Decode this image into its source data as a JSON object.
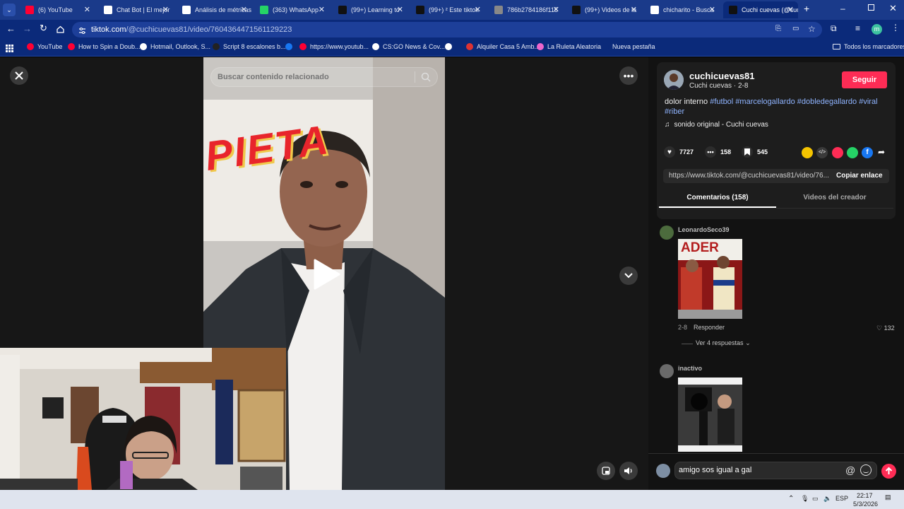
{
  "tabs": [
    {
      "label": "(6) YouTube",
      "icon": "youtube-icon",
      "color": "#ff0033"
    },
    {
      "label": "Chat Bot | El mejor",
      "icon": "chatbot-icon",
      "color": "#ffffff"
    },
    {
      "label": "Análisis de métricas",
      "icon": "analytics-icon",
      "color": "#ffffff"
    },
    {
      "label": "(363) WhatsApp",
      "icon": "whatsapp-icon",
      "color": "#25d366"
    },
    {
      "label": "(99+) Learning to",
      "icon": "tiktok-icon",
      "color": "#111111"
    },
    {
      "label": "(99+) ² Este tiktok",
      "icon": "tiktok-icon",
      "color": "#111111"
    },
    {
      "label": "786b2784186f115",
      "icon": "globe-icon",
      "color": "#888888"
    },
    {
      "label": "(99+) Videos de la",
      "icon": "tiktok-icon",
      "color": "#111111"
    },
    {
      "label": "chicharito - Busca",
      "icon": "google-icon",
      "color": "#ffffff"
    },
    {
      "label": "Cuchi cuevas (@cuchi",
      "icon": "tiktok-icon",
      "color": "#111111"
    }
  ],
  "address": {
    "host": "tiktok.com",
    "path": "/@cuchicuevas81/video/7604364471561129223"
  },
  "bookmarks": [
    {
      "label": "YouTube",
      "color": "#ff0033"
    },
    {
      "label": "How to Spin a Doub...",
      "color": "#ff0033"
    },
    {
      "label": "Hotmail, Outlook, S...",
      "color": "#ffffff"
    },
    {
      "label": "Script 8 escalones b...",
      "color": "#222222"
    },
    {
      "label": "",
      "color": "#1877f2"
    },
    {
      "label": "https://www.youtub...",
      "color": "#ff0033"
    },
    {
      "label": "CS:GO News & Cov...",
      "color": "#ffffff"
    },
    {
      "label": "",
      "color": "#ffffff"
    },
    {
      "label": "Alquiler Casa 5 Amb...",
      "color": "#d33"
    },
    {
      "label": "La Ruleta Aleatoria",
      "color": "#e6c"
    },
    {
      "label": "Nueva pestaña",
      "color": "#0b2a7a"
    }
  ],
  "bookmarks_all": "Todos los marcadores",
  "search": {
    "placeholder": "Buscar contenido relacionado"
  },
  "video": {
    "poster_text": "PIETA"
  },
  "author": {
    "handle": "cuchicuevas81",
    "name": "Cuchi cuevas",
    "date": "2-8",
    "follow_label": "Seguir",
    "separator": "·"
  },
  "caption": {
    "text": "dolor interno",
    "hashtags": [
      "#futbol",
      "#marcelogallardo",
      "#dobledegallardo",
      "#viral",
      "#riber"
    ]
  },
  "sound": "sonido original - Cuchi cuevas",
  "stats": {
    "likes": "7727",
    "comments": "158",
    "saves": "545"
  },
  "share": {
    "url": "https://www.tiktok.com/@cuchicuevas81/video/76...",
    "copy_label": "Copiar enlace"
  },
  "right_tabs": {
    "comments": "Comentarios (158)",
    "creator_videos": "Videos del creador"
  },
  "comments": [
    {
      "user": "LeonardoSeco39",
      "date": "2-8",
      "reply": "Responder",
      "likes": "132",
      "view_replies": "Ver 4 respuestas",
      "media": "ADER"
    },
    {
      "user": "inactivo"
    }
  ],
  "composer": {
    "value": "amigo sos igual a gal"
  },
  "taskbar": {
    "lang": "ESP",
    "time": "22:17",
    "date": "5/3/2026"
  },
  "colors": {
    "accent": "#fe2c55",
    "link": "#8fb4ff",
    "browser": "#0b2a7a"
  }
}
